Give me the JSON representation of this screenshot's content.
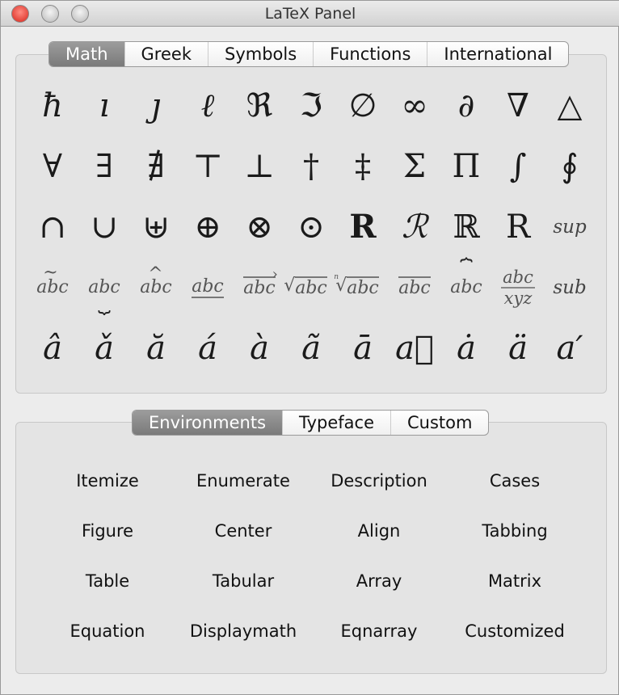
{
  "window": {
    "title": "LaTeX Panel"
  },
  "top_tabs": [
    {
      "label": "Math",
      "active": true
    },
    {
      "label": "Greek"
    },
    {
      "label": "Symbols"
    },
    {
      "label": "Functions"
    },
    {
      "label": "International"
    }
  ],
  "symbols": [
    {
      "glyph": "ħ",
      "name": "hbar"
    },
    {
      "glyph": "ı",
      "name": "imath"
    },
    {
      "glyph": "ȷ",
      "name": "jmath"
    },
    {
      "glyph": "ℓ",
      "name": "ell"
    },
    {
      "glyph": "ℜ",
      "name": "re",
      "style": "up"
    },
    {
      "glyph": "ℑ",
      "name": "im",
      "style": "up"
    },
    {
      "glyph": "∅",
      "name": "emptyset",
      "style": "up"
    },
    {
      "glyph": "∞",
      "name": "infty",
      "style": "up"
    },
    {
      "glyph": "∂",
      "name": "partial",
      "style": "up"
    },
    {
      "glyph": "∇",
      "name": "nabla",
      "style": "up"
    },
    {
      "glyph": "△",
      "name": "triangle",
      "style": "up"
    },
    {
      "glyph": "∀",
      "name": "forall",
      "style": "up"
    },
    {
      "glyph": "∃",
      "name": "exists",
      "style": "up"
    },
    {
      "glyph": "∄",
      "name": "nexists",
      "style": "up"
    },
    {
      "glyph": "⊤",
      "name": "top",
      "style": "up"
    },
    {
      "glyph": "⊥",
      "name": "bot",
      "style": "up"
    },
    {
      "glyph": "†",
      "name": "dagger",
      "style": "up"
    },
    {
      "glyph": "‡",
      "name": "ddagger",
      "style": "up"
    },
    {
      "glyph": "Σ",
      "name": "sum",
      "style": "up"
    },
    {
      "glyph": "Π",
      "name": "prod",
      "style": "up"
    },
    {
      "glyph": "∫",
      "name": "int",
      "style": "up"
    },
    {
      "glyph": "∮",
      "name": "oint",
      "style": "up"
    },
    {
      "glyph": "∩",
      "name": "cap",
      "style": "up"
    },
    {
      "glyph": "∪",
      "name": "cup",
      "style": "up"
    },
    {
      "glyph": "⊎",
      "name": "uplus",
      "style": "up"
    },
    {
      "glyph": "⊕",
      "name": "oplus",
      "style": "up"
    },
    {
      "glyph": "⊗",
      "name": "otimes",
      "style": "up"
    },
    {
      "glyph": "⊙",
      "name": "odot",
      "style": "up"
    },
    {
      "glyph": "R",
      "name": "mathbf",
      "style": "bold"
    },
    {
      "glyph": "ℛ",
      "name": "mathcal"
    },
    {
      "glyph": "ℝ",
      "name": "mathbb",
      "style": "up"
    },
    {
      "glyph": "R",
      "name": "mathrm",
      "style": "up"
    },
    {
      "glyph": "sup",
      "name": "superscript",
      "style": "small"
    },
    {
      "glyph": "abc",
      "name": "widetilde",
      "deco": "widetilde"
    },
    {
      "glyph": "abc",
      "name": "underbrace",
      "deco": "underbrace"
    },
    {
      "glyph": "abc",
      "name": "widehat",
      "deco": "widehat"
    },
    {
      "glyph": "abc",
      "name": "underline",
      "deco": "underline"
    },
    {
      "glyph": "abc",
      "name": "overrightarrow",
      "deco": "overrightarrow"
    },
    {
      "glyph": "abc",
      "name": "sqrt",
      "deco": "sqrt"
    },
    {
      "glyph": "abc",
      "name": "nth-root",
      "deco": "root"
    },
    {
      "glyph": "abc",
      "name": "overline",
      "deco": "overline"
    },
    {
      "glyph": "abc",
      "name": "overbrace",
      "deco": "overbrace"
    },
    {
      "glyph": "abc",
      "name": "frac",
      "deco": "frac",
      "denominator": "xyz"
    },
    {
      "glyph": "sub",
      "name": "subscript",
      "style": "small"
    },
    {
      "glyph": "â",
      "name": "hat"
    },
    {
      "glyph": "ǎ",
      "name": "check"
    },
    {
      "glyph": "ă",
      "name": "breve"
    },
    {
      "glyph": "á",
      "name": "acute"
    },
    {
      "glyph": "à",
      "name": "grave"
    },
    {
      "glyph": "ã",
      "name": "tilde"
    },
    {
      "glyph": "ā",
      "name": "bar"
    },
    {
      "glyph": "a⃗",
      "name": "vec"
    },
    {
      "glyph": "ȧ",
      "name": "dot"
    },
    {
      "glyph": "ä",
      "name": "ddot"
    },
    {
      "glyph": "a′",
      "name": "prime"
    }
  ],
  "bottom_tabs": [
    {
      "label": "Environments",
      "active": true
    },
    {
      "label": "Typeface"
    },
    {
      "label": "Custom"
    }
  ],
  "environments": [
    "Itemize",
    "Enumerate",
    "Description",
    "Cases",
    "Figure",
    "Center",
    "Align",
    "Tabbing",
    "Table",
    "Tabular",
    "Array",
    "Matrix",
    "Equation",
    "Displaymath",
    "Eqnarray",
    "Customized"
  ]
}
